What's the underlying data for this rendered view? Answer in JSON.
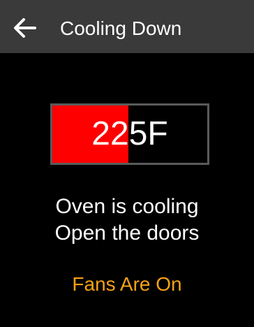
{
  "header": {
    "back_icon": "arrow-left-icon",
    "title": "Cooling Down"
  },
  "temperature": {
    "value": "225F",
    "fill_fraction": 0.49,
    "fill_color": "#ff0000"
  },
  "messages": {
    "line1": "Oven is cooling",
    "line2": "Open the doors"
  },
  "status": {
    "text": "Fans Are On",
    "color": "#f5a117"
  },
  "colors": {
    "header_bg": "#3a3a3a",
    "background": "#000000",
    "text": "#ffffff"
  }
}
